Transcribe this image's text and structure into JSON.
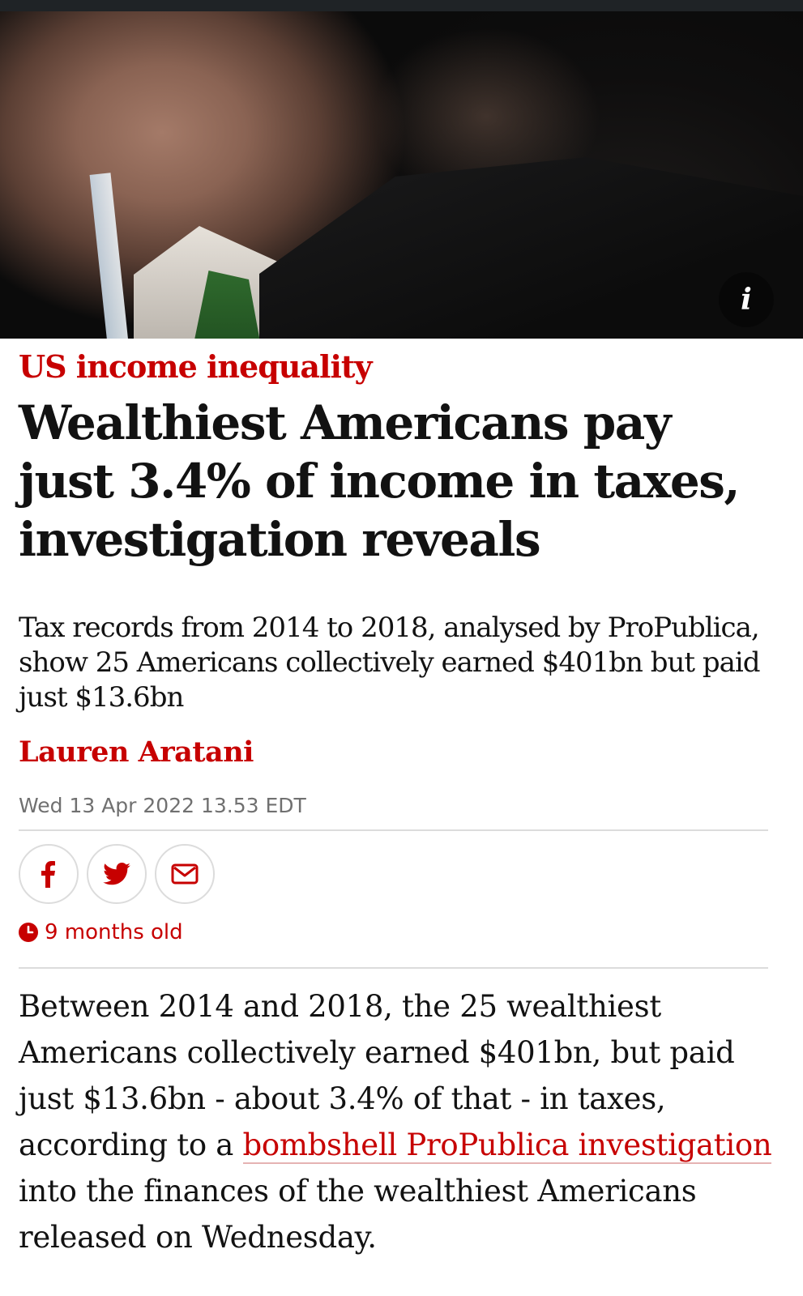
{
  "hero": {
    "info_button_label": "i"
  },
  "article": {
    "kicker": "US income inequality",
    "headline": "Wealthiest Americans pay just 3.4% of income in taxes, investigation reveals",
    "standfirst": "Tax records from 2014 to 2018, analysed by ProPublica, show 25 Americans collectively earned $401bn but paid just $13.6bn",
    "author": "Lauren Aratani",
    "date": "Wed 13 Apr 2022 13.53 EDT",
    "age": "9 months old",
    "body": {
      "before_link": "Between 2014 and 2018, the 25 wealthiest Americans collectively earned $401bn, but paid just $13.6bn - about 3.4% of that - in taxes, according to a ",
      "link_text": "bombshell ProPublica investigation",
      "after_link": " into the finances of the wealthiest Americans released on Wednesday."
    }
  },
  "share": {
    "icons": [
      "facebook-icon",
      "twitter-icon",
      "email-icon"
    ]
  },
  "colors": {
    "accent": "#c70000",
    "text": "#121212",
    "muted": "#707070",
    "rule": "#dcdcdc"
  }
}
